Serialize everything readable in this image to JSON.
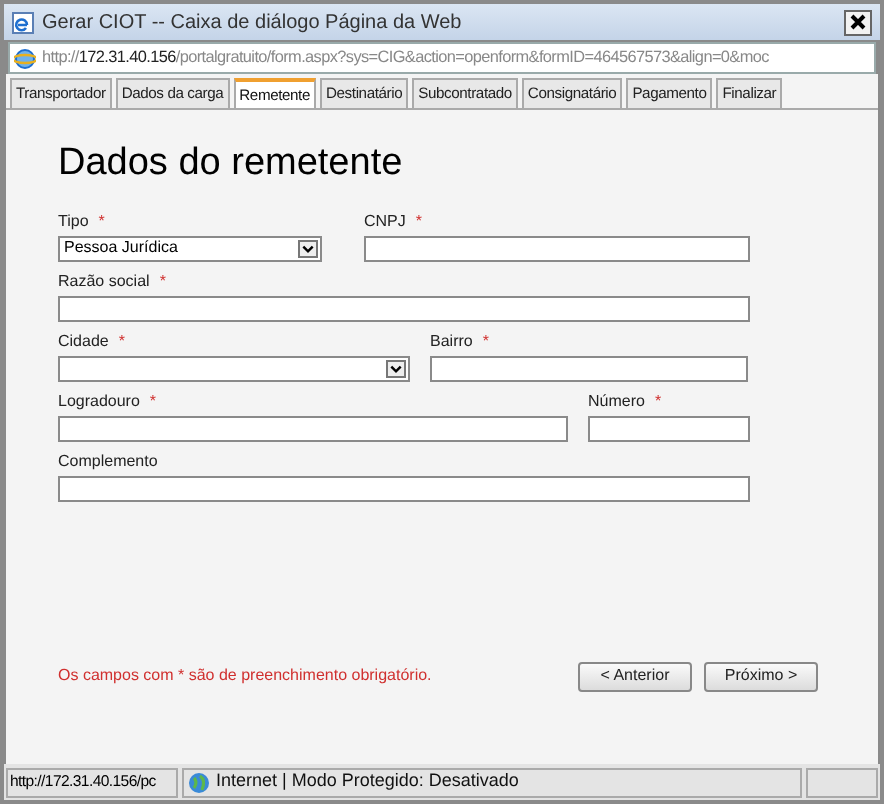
{
  "window": {
    "title": "Gerar CIOT -- Caixa de diálogo Página da Web"
  },
  "address_bar": {
    "url": "http://**172.31.40.156**/portalgratuito/form.aspx?sys=CIG&action=openform&formID=464567573&align=0&moc"
  },
  "tabs": [
    {
      "label": "Transportador",
      "selected": false
    },
    {
      "label": "Dados da carga",
      "selected": false
    },
    {
      "label": "Remetente",
      "selected": true
    },
    {
      "label": "Destinatário",
      "selected": false
    },
    {
      "label": "Subcontratado",
      "selected": false
    },
    {
      "label": "Consignatário",
      "selected": false
    },
    {
      "label": "Pagamento",
      "selected": false
    },
    {
      "label": "Finalizar",
      "selected": false
    }
  ],
  "heading": "Dados do remetente",
  "rows": [
    {
      "fields": [
        {
          "kind": "select",
          "label": "Tipo",
          "marker": "*",
          "value": "Pessoa Jurídica"
        },
        {
          "kind": "text",
          "label": "CNPJ",
          "marker": "*"
        }
      ]
    },
    {
      "fields": [
        {
          "kind": "text",
          "label": "Razão social",
          "marker": "*"
        }
      ]
    },
    {
      "fields": [
        {
          "kind": "select",
          "label": "Cidade",
          "marker": "*"
        },
        {
          "kind": "text",
          "label": "Bairro",
          "marker": "*"
        }
      ]
    },
    {
      "fields": [
        {
          "kind": "text",
          "label": "Logradouro",
          "marker": "*"
        },
        {
          "kind": "text",
          "label": "Número",
          "marker": "*"
        }
      ]
    },
    {
      "fields": [
        {
          "kind": "text",
          "label": "Complemento"
        }
      ]
    }
  ],
  "note": "Os campos com * são de preenchimento obrigatório.",
  "buttons": [
    "< Anterior",
    "Próximo >"
  ],
  "status_bar": {
    "url": "http://172.31.40.156/pc",
    "zone": "Internet | Modo Protegido: Desativado"
  }
}
